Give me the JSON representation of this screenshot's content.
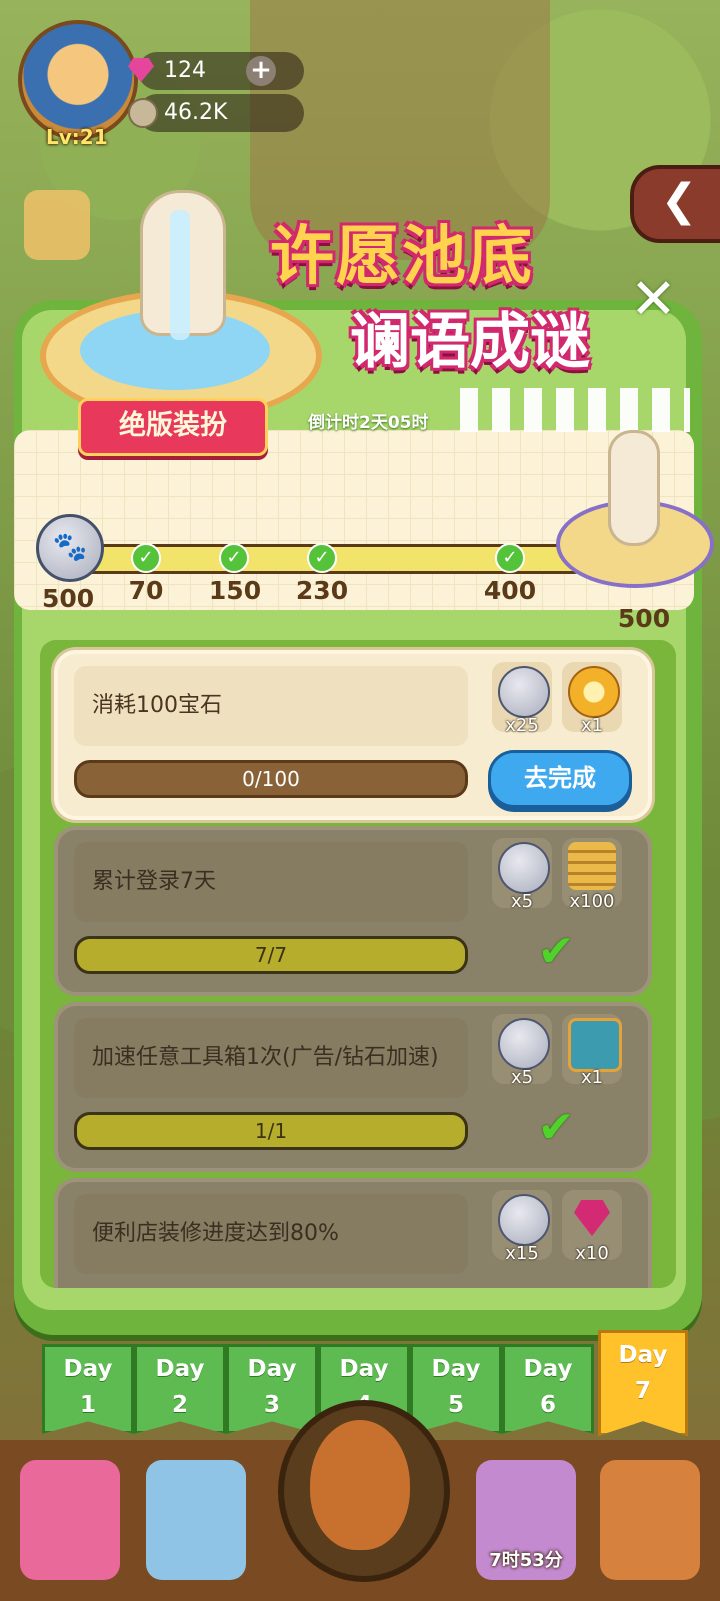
{
  "profile": {
    "level": "Lv:21",
    "gems": "124",
    "coins": "46.2K",
    "add_symbol": "+"
  },
  "event": {
    "title_line1": "许愿池底",
    "title_line2": "谰语成谜",
    "badge": "绝版装扮",
    "countdown": "倒计时2天05时",
    "back_symbol": "❮",
    "close_symbol": "✕"
  },
  "progress": {
    "current": "500",
    "milestones": [
      {
        "label": "70",
        "claimed": true
      },
      {
        "label": "150",
        "claimed": true
      },
      {
        "label": "230",
        "claimed": true
      },
      {
        "label": "400",
        "claimed": true
      },
      {
        "label": "500",
        "claimed": false
      }
    ]
  },
  "tasks": [
    {
      "name": "消耗100宝石",
      "progress_text": "0/100",
      "progress": 0,
      "rewards": [
        {
          "icon": "paw-coin-icon",
          "count": "x25"
        },
        {
          "icon": "medal-icon",
          "count": "x1"
        }
      ],
      "status": "active",
      "button": "去完成"
    },
    {
      "name": "累计登录7天",
      "progress_text": "7/7",
      "progress": 1,
      "rewards": [
        {
          "icon": "paw-coin-icon",
          "count": "x5"
        },
        {
          "icon": "coin-stack-icon",
          "count": "x100"
        }
      ],
      "status": "done"
    },
    {
      "name": "加速任意工具箱1次(广告/钻石加速)",
      "progress_text": "1/1",
      "progress": 1,
      "rewards": [
        {
          "icon": "paw-coin-icon",
          "count": "x5"
        },
        {
          "icon": "toolbox-chest-icon",
          "count": "x1"
        }
      ],
      "status": "done"
    },
    {
      "name": "便利店装修进度达到80%",
      "progress_text": "",
      "progress": 0,
      "rewards": [
        {
          "icon": "paw-coin-icon",
          "count": "x15"
        },
        {
          "icon": "gem-pile-icon",
          "count": "x10"
        }
      ],
      "status": "partial"
    }
  ],
  "days": [
    {
      "word": "Day",
      "num": "1",
      "active": false
    },
    {
      "word": "Day",
      "num": "2",
      "active": false
    },
    {
      "word": "Day",
      "num": "3",
      "active": false
    },
    {
      "word": "Day",
      "num": "4",
      "active": false
    },
    {
      "word": "Day",
      "num": "5",
      "active": false
    },
    {
      "word": "Day",
      "num": "6",
      "active": false
    },
    {
      "word": "Day",
      "num": "7",
      "active": true
    }
  ],
  "bottom_bar": {
    "timer": "7时53分"
  },
  "colors": {
    "panel_green": "#6fb43c",
    "active_day": "#ffc22a",
    "go_button": "#3fa9f0",
    "title_pink": "#d2296e"
  }
}
